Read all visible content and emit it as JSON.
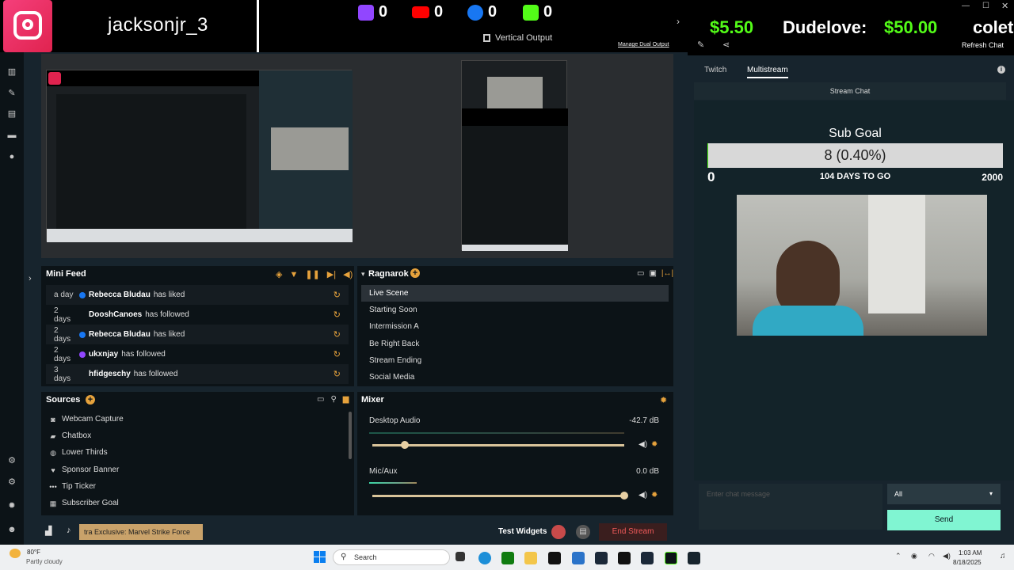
{
  "header": {
    "username": "jacksonjr_3",
    "platforms": [
      {
        "name": "twitch",
        "count": "0",
        "color": "#9146ff"
      },
      {
        "name": "youtube",
        "count": "0",
        "color": "#ff0000"
      },
      {
        "name": "facebook",
        "count": "0",
        "color": "#1877f2"
      },
      {
        "name": "kick",
        "count": "0",
        "color": "#53fc18"
      }
    ],
    "vertical_output": "Vertical Output",
    "manage_dual_output": "Manage Dual Output"
  },
  "mini_feed": {
    "title": "Mini Feed",
    "items": [
      {
        "time": "a day",
        "name": "Rebecca Bludau",
        "action": "has liked",
        "dot": "#1877f2"
      },
      {
        "time": "2 days",
        "name": "DooshCanoes",
        "action": "has followed",
        "dot": ""
      },
      {
        "time": "2 days",
        "name": "Rebecca Bludau",
        "action": "has liked",
        "dot": "#1877f2"
      },
      {
        "time": "2 days",
        "name": "ukxnjay",
        "action": "has followed",
        "dot": "#9146ff"
      },
      {
        "time": "3 days",
        "name": "hfidgeschy",
        "action": "has followed",
        "dot": ""
      }
    ]
  },
  "scenes": {
    "title": "Ragnarok",
    "items": [
      "Live Scene",
      "Starting Soon",
      "Intermission A",
      "Be Right Back",
      "Stream Ending",
      "Social Media"
    ]
  },
  "sources": {
    "title": "Sources",
    "items": [
      {
        "label": "Webcam Capture",
        "icon": "webcam-icon",
        "glyph": "◙"
      },
      {
        "label": "Chatbox",
        "icon": "chat-icon",
        "glyph": "▰"
      },
      {
        "label": "Lower Thirds",
        "icon": "globe-icon",
        "glyph": "◍"
      },
      {
        "label": "Sponsor Banner",
        "icon": "heart-icon",
        "glyph": "♥"
      },
      {
        "label": "Tip Ticker",
        "icon": "dots-icon",
        "glyph": "•••"
      },
      {
        "label": "Subscriber Goal",
        "icon": "calendar-icon",
        "glyph": "▦"
      }
    ]
  },
  "mixer": {
    "title": "Mixer",
    "channels": [
      {
        "name": "Desktop Audio",
        "db": "-42.7 dB",
        "level": 0.05
      },
      {
        "name": "Mic/Aux",
        "db": "0.0 dB",
        "level": 1.0
      }
    ]
  },
  "bottom_bar": {
    "ad_text": "tra Exclusive: Marvel Strike Force",
    "test_widgets": "Test Widgets",
    "end_stream": "End Stream"
  },
  "right_panel": {
    "ticker": {
      "amount1": "$5.50",
      "name": "Dudelove:",
      "amount2": "$50.00",
      "trail": "colet"
    },
    "refresh_chat": "Refresh Chat",
    "tabs": [
      "Twitch",
      "Multistream"
    ],
    "active_tab": "Multistream",
    "stream_chat": "Stream Chat",
    "sub_goal": {
      "title": "Sub Goal",
      "value": "8 (0.40%)",
      "min": "0",
      "max": "2000",
      "days": "104 DAYS TO GO",
      "progress": 0.004
    },
    "chat_placeholder": "Enter chat message",
    "audience": "All",
    "send": "Send"
  },
  "taskbar": {
    "weather_temp": "80°F",
    "weather_desc": "Partly cloudy",
    "search": "Search",
    "time": "1:03 AM",
    "date": "8/18/2025"
  }
}
